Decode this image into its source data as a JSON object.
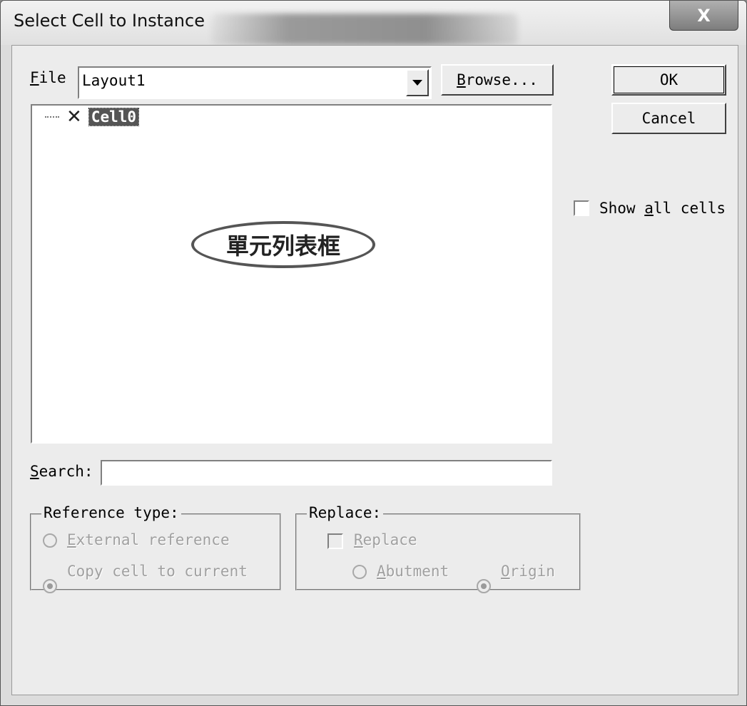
{
  "window": {
    "title": "Select Cell to Instance",
    "close_glyph": "X"
  },
  "file": {
    "label_first": "F",
    "label_rest": "ile",
    "value": "Layout1",
    "browse_first": "B",
    "browse_rest": "rowse..."
  },
  "buttons": {
    "ok": "OK",
    "cancel": "Cancel"
  },
  "tree": {
    "items": [
      {
        "name": "Cell0",
        "icon": "x-icon"
      }
    ]
  },
  "annotation": "單元列表框",
  "show_all": {
    "pre": "Show ",
    "ul": "a",
    "post": "ll cells",
    "checked": false
  },
  "search": {
    "label_first": "S",
    "label_rest": "earch:",
    "value": ""
  },
  "reference_type": {
    "legend": "Reference type:",
    "external": {
      "ul": "E",
      "rest": "xternal reference",
      "selected": false
    },
    "copy": {
      "text": "Copy cell to current",
      "selected": true
    }
  },
  "replace_group": {
    "legend": "Replace:",
    "replace": {
      "ul": "R",
      "rest": "eplace",
      "checked": false
    },
    "abutment": {
      "ul": "A",
      "rest": "butment",
      "selected": false
    },
    "origin": {
      "ul": "O",
      "rest": "rigin",
      "selected": true
    }
  }
}
